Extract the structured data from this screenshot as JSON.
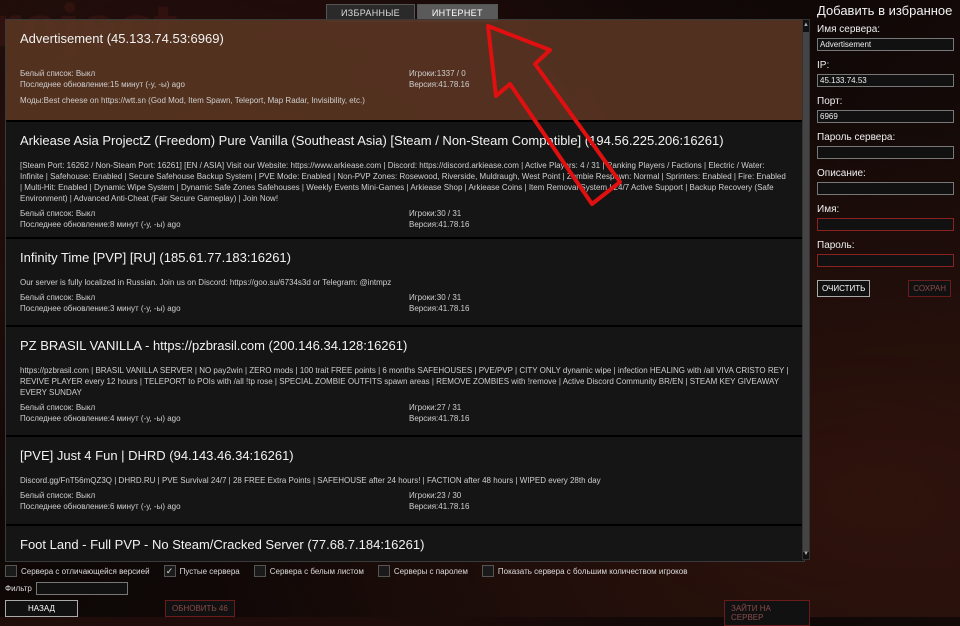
{
  "tabs": [
    {
      "label": "ИЗБРАННЫЕ",
      "active": false
    },
    {
      "label": "ИНТЕРНЕТ",
      "active": true
    }
  ],
  "servers": [
    {
      "title": "Advertisement (45.133.74.53:6969)",
      "whitelist": "Белый список: Выкл",
      "updated": "Последнее обновление:15 минут (-у, -ы) ago",
      "players": "Игроки:1337 / 0",
      "version": "Версия:41.78.16",
      "mods": "Моды:Best cheese on https://wtt.sn (God Mod,  Item Spawn,  Teleport,  Map Radar,  Invisibility,  etc.)"
    },
    {
      "title": "Arkiease Asia ProjectZ (Freedom) Pure Vanilla (Southeast Asia) [Steam / Non-Steam Compatible] (194.56.225.206:16261)",
      "desc": "[Steam Port: 16262 / Non-Steam Port: 16261] [EN / ASIA] Visit our Website: https://www.arkiease.com | Discord: https://discord.arkiease.com | Active Players: 4 / 31 | Ranking Players / Factions | Electric / Water: Infinite | Safehouse: Enabled | Secure Safehouse Backup System | PVE Mode: Enabled | Non-PVP Zones: Rosewood, Riverside, Muldraugh, West Point | Zombie Respawn: Normal | Sprinters: Enabled | Fire: Enabled | Multi-Hit: Enabled | Dynamic Wipe System | Dynamic Safe Zones Safehouses | Weekly Events Mini-Games | Arkiease Shop | Arkiease Coins | Item Removal System | 24/7 Active Support | Backup Recovery (Safe Environment) | Advanced Anti-Cheat (Fair Secure Gameplay) | Join Now!",
      "whitelist": "Белый список: Выкл",
      "updated": "Последнее обновление:8 минут (-у, -ы) ago",
      "players": "Игроки:30 / 31",
      "version": "Версия:41.78.16"
    },
    {
      "title": "Infinity Time [PVP] [RU] (185.61.77.183:16261)",
      "desc": "Our server is fully localized in Russian. Join us on Discord: https://goo.su/6734s3d or Telegram: @intmpz",
      "whitelist": "Белый список: Выкл",
      "updated": "Последнее обновление:3 минут (-у, -ы) ago",
      "players": "Игроки:30 / 31",
      "version": "Версия:41.78.16"
    },
    {
      "title": "PZ BRASIL VANILLA  - https://pzbrasil.com (200.146.34.128:16261)",
      "desc": "https://pzbrasil.com | BRASIL VANILLA SERVER | NO pay2win | ZERO mods | 100 trait FREE points | 6 months SAFEHOUSES | PVE/PVP | CITY ONLY dynamic wipe | infection HEALING with /all VIVA CRISTO REY | REVIVE PLAYER every 12 hours | TELEPORT to POIs with /all !tp rose | SPECIAL ZOMBIE OUTFITS spawn areas | REMOVE ZOMBIES with !remove | Active Discord Community BR/EN | STEAM KEY GIVEAWAY EVERY SUNDAY",
      "whitelist": "Белый список: Выкл",
      "updated": "Последнее обновление:4 минут (-у, -ы) ago",
      "players": "Игроки:27 / 31",
      "version": "Версия:41.78.16"
    },
    {
      "title": "[PVE] Just 4 Fun | DHRD (94.143.46.34:16261)",
      "desc": "Discord.gg/FnT56mQZ3Q | DHRD.RU | PVE Survival 24/7 | 28 FREE Extra Points | SAFEHOUSE after 24 hours! | FACTION after 48 hours | WIPED every 28th day",
      "whitelist": "Белый список: Выкл",
      "updated": "Последнее обновление:6 минут (-у, -ы) ago",
      "players": "Игроки:23 / 30",
      "version": "Версия:41.78.16"
    },
    {
      "title": "Foot Land - Full PVP - No Steam/Cracked Server (77.68.7.184:16261)"
    }
  ],
  "panel": {
    "title": "Добавить в избранное",
    "server_name_label": "Имя сервера:",
    "server_name_value": "Advertisement",
    "ip_label": "IP:",
    "ip_value": "45.133.74.53",
    "port_label": "Порт:",
    "port_value": "6969",
    "password_label": "Пароль сервера:",
    "description_label": "Описание:",
    "name_label": "Имя:",
    "user_password_label": "Пароль:",
    "clear_button": "ОЧИСТИТЬ",
    "save_button": "СОХРАН"
  },
  "filters": [
    {
      "label": "Сервера с отличающейся версией",
      "checked": false
    },
    {
      "label": "Пустые сервера",
      "checked": true
    },
    {
      "label": "Сервера с белым листом",
      "checked": false
    },
    {
      "label": "Серверы с паролем",
      "checked": false
    },
    {
      "label": "Показать сервера с большим количеством игроков",
      "checked": false
    }
  ],
  "filter_label": "Фильтр",
  "bottom": {
    "back": "НАЗАД",
    "refresh": "ОБНОВИТЬ 46",
    "join": "ЗАЙТИ НА СЕРВЕР"
  },
  "colors": {
    "selected_row": "#583422",
    "arrow": "#e01010",
    "disabled_border": "#6a1c1c"
  }
}
